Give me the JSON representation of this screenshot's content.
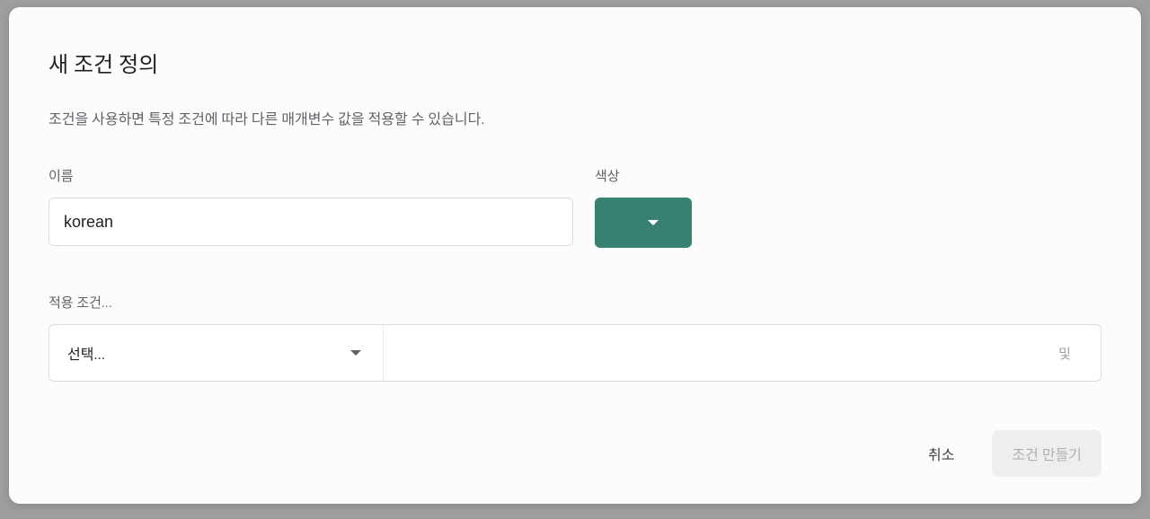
{
  "dialog": {
    "title": "새 조건 정의",
    "description": "조건을 사용하면 특정 조건에 따라 다른 매개변수 값을 적용할 수 있습니다."
  },
  "form": {
    "name_label": "이름",
    "name_value": "korean",
    "color_label": "색상",
    "color_value": "#388172"
  },
  "condition": {
    "section_label": "적용 조건...",
    "select_placeholder": "선택...",
    "operator_label": "및"
  },
  "actions": {
    "cancel": "취소",
    "create": "조건 만들기"
  }
}
